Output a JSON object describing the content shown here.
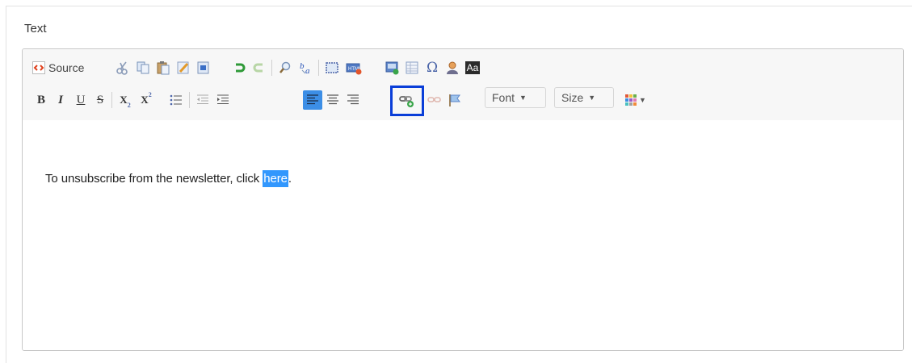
{
  "field": {
    "label": "Text"
  },
  "toolbar": {
    "source_label": "Source",
    "font_label": "Font",
    "size_label": "Size",
    "special_char_glyph": "Ω",
    "aa_label": "Aa",
    "bold_label": "B",
    "italic_label": "I",
    "underline_label": "U",
    "strike_label": "S",
    "subscript_label": "X",
    "superscript_label": "X"
  },
  "content": {
    "before_selection": "To unsubscribe from the newsletter, click ",
    "selected_text": "here",
    "after_selection": "."
  },
  "colors": {
    "selection": "#3297fd",
    "focus_ring": "#0a3ed8",
    "active_button": "#3c8ee6"
  }
}
